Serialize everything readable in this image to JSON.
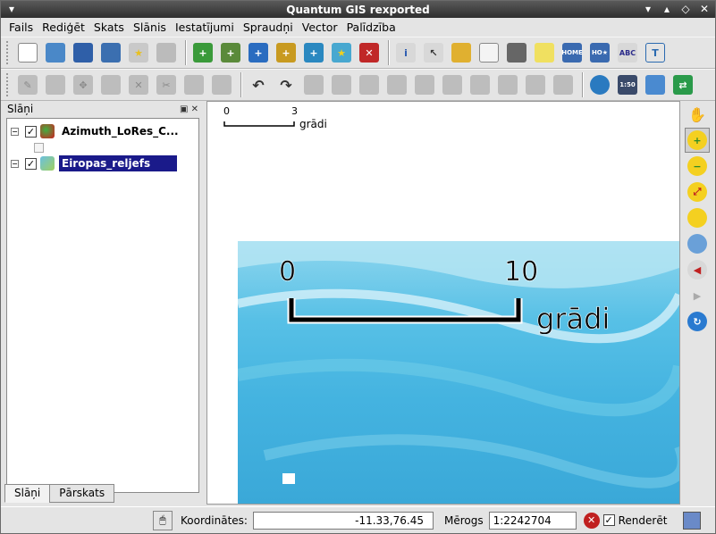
{
  "window": {
    "title": "Quantum GIS rexported"
  },
  "menu": {
    "items": [
      "Fails",
      "Rediģēt",
      "Skats",
      "Slānis",
      "Iestatījumi",
      "Spraudņi",
      "Vector",
      "Palīdzība"
    ]
  },
  "layers_panel": {
    "title": "Slāņi",
    "layers": [
      {
        "name": "Azimuth_LoRes_C...",
        "checked": true,
        "selected": false
      },
      {
        "name": "Eiropas_reljefs",
        "checked": true,
        "selected": true
      }
    ],
    "tabs": [
      "Slāņi",
      "Pārskats"
    ]
  },
  "map": {
    "small_scale": {
      "left": "0",
      "right": "3",
      "unit": "grādi"
    },
    "big_scale": {
      "left": "0",
      "right": "10",
      "unit": "grādi"
    }
  },
  "statusbar": {
    "coords_label": "Koordinātes:",
    "coords_value": "-11.33,76.45",
    "scale_label": "Mērogs",
    "scale_value": "1:2242704",
    "render_label": "Renderēt",
    "render_checked": true
  },
  "colors": {
    "selection": "#1a1a8a",
    "water": "#44b3e0"
  }
}
